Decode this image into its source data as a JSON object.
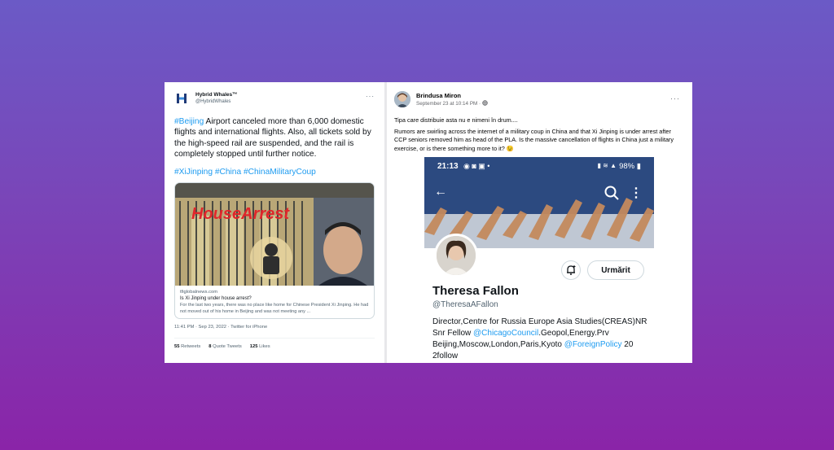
{
  "tweet": {
    "display_name": "Hybrid Whales™",
    "handle": "@HybridWhales",
    "text_hashtag": "#Beijing",
    "text_body": " Airport canceled more than 6,000 domestic flights and international flights. Also, all tickets sold by the high-speed rail are suspended, and the rail is completely stopped until further notice.",
    "hashtags": "#XiJinping #China #ChinaMilitaryCoup",
    "card": {
      "image_caption": "HouseArrest",
      "domain": "tfiglobalnews.com",
      "title": "Is Xi Jinping under house arrest?",
      "description": "For the last two years, there was no place like home for Chinese President Xi Jinping. He had not moved out of his home in Beijing and was not meeting any ..."
    },
    "timestamp": "11:41 PM · Sep 23, 2022 · Twitter for iPhone",
    "retweets_count": "55",
    "retweets_label": "Retweets",
    "quotes_count": "8",
    "quotes_label": "Quote Tweets",
    "likes_count": "125",
    "likes_label": "Likes"
  },
  "facebook_post": {
    "author": "Brindusa Miron",
    "date": "September 23 at 10:14 PM · ",
    "text_line1": "Tipa care distribuie asta nu e nimeni în drum....",
    "text_line2": "Rumors are swirling across the internet of a military coup in China and that Xi Jinping is under arrest after CCP seniors removed him as head of the PLA. Is the massive cancellation of flights in China just a military exercise, or is there something more to it? 😉"
  },
  "phone_screenshot": {
    "status_time": "21:13",
    "battery": "98%",
    "profile_name": "Theresa Fallon",
    "profile_handle": "@TheresaAFallon",
    "follow_label": "Urmărit",
    "bio_part1": "Director,Centre for Russia Europe Asia Studies(CREAS)NR Snr Fellow ",
    "bio_link1": "@ChicagoCouncil",
    "bio_part2": ".Geopol,Energy.Prv Beijing,Moscow,London,Paris,Kyoto ",
    "bio_link2": "@ForeignPolicy",
    "bio_part3": " 20 2follow"
  }
}
